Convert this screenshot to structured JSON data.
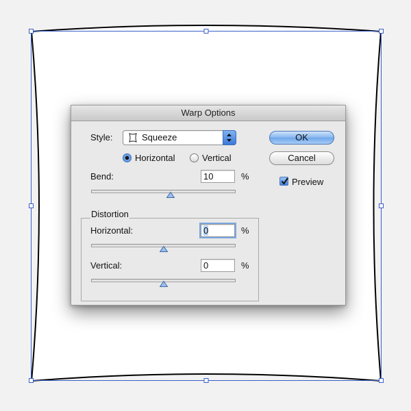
{
  "dialog": {
    "title": "Warp Options",
    "style": {
      "label": "Style:",
      "selected": "Squeeze",
      "icon": "squeeze-warp-icon"
    },
    "orientation": {
      "horizontal_label": "Horizontal",
      "vertical_label": "Vertical",
      "selected": "Horizontal"
    },
    "bend": {
      "label": "Bend:",
      "value": "10",
      "unit": "%",
      "slider_fraction": 0.55
    },
    "distortion": {
      "group_label": "Distortion",
      "horizontal": {
        "label": "Horizontal:",
        "value": "0",
        "unit": "%",
        "slider_fraction": 0.5
      },
      "vertical": {
        "label": "Vertical:",
        "value": "0",
        "unit": "%",
        "slider_fraction": 0.5
      }
    },
    "buttons": {
      "ok": "OK",
      "cancel": "Cancel"
    },
    "preview": {
      "label": "Preview",
      "checked": true
    }
  },
  "colors": {
    "selection": "#3a5fc8",
    "accent": "#3b79d8",
    "dialog_bg": "#e9e9e9"
  }
}
